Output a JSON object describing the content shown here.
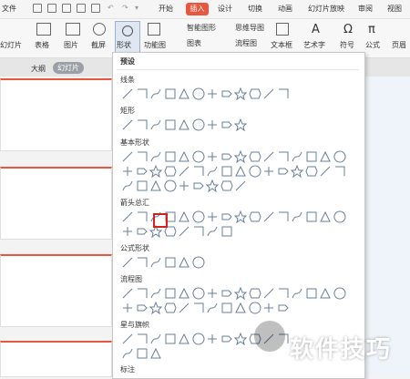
{
  "titlebar": {
    "file_label": "文件",
    "tabs": [
      "开始",
      "插入",
      "设计",
      "切换",
      "动画",
      "幻灯片放映",
      "审阅",
      "视图"
    ],
    "active_tab": "插入"
  },
  "ribbon": {
    "new_slide": "幻灯片",
    "table": "表格",
    "picture": "图片",
    "screenshot": "截屏",
    "shapes": "形状",
    "function_chart": "功能图",
    "smart_graphic": "智能图形",
    "chart": "图表",
    "mind_map": "思维导图",
    "flowchart": "流程图",
    "textbox": "文本框",
    "wordart": "艺术字",
    "symbol": "符号",
    "formula": "公式",
    "header_footer": "页眉"
  },
  "outline_tab": "大纲",
  "slides_tab": "幻灯片",
  "shapes_menu": {
    "preset_label": "预设",
    "sections": {
      "lines": "线条",
      "rectangles": "矩形",
      "basic": "基本形状",
      "arrows": "箭头总汇",
      "equation": "公式形状",
      "flowchart": "流程图",
      "stars": "星与旗帜",
      "callouts": "标注"
    },
    "highlighted_shape": "folded-corner"
  },
  "watermark": "软件技巧",
  "colors": {
    "accent": "#e9573f",
    "highlight": "#d62020",
    "shape_stroke": "#6a7f99"
  }
}
